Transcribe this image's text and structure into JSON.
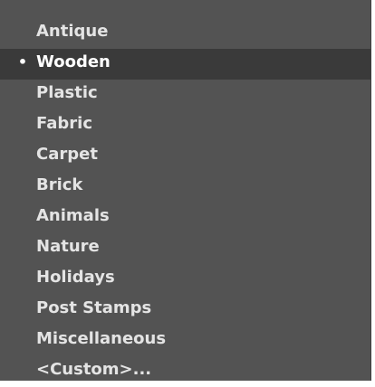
{
  "menu": {
    "selected_marker": "•",
    "items": [
      {
        "label": "Antique"
      },
      {
        "label": "Wooden"
      },
      {
        "label": "Plastic"
      },
      {
        "label": "Fabric"
      },
      {
        "label": "Carpet"
      },
      {
        "label": "Brick"
      },
      {
        "label": "Animals"
      },
      {
        "label": "Nature"
      },
      {
        "label": "Holidays"
      },
      {
        "label": "Post Stamps"
      },
      {
        "label": "Miscellaneous"
      },
      {
        "label": "<Custom>..."
      }
    ],
    "selected_item": "Wooden"
  },
  "colors": {
    "menu_background": "#535353",
    "selected_background": "#3a3a3a",
    "text": "#e4e4e4"
  }
}
